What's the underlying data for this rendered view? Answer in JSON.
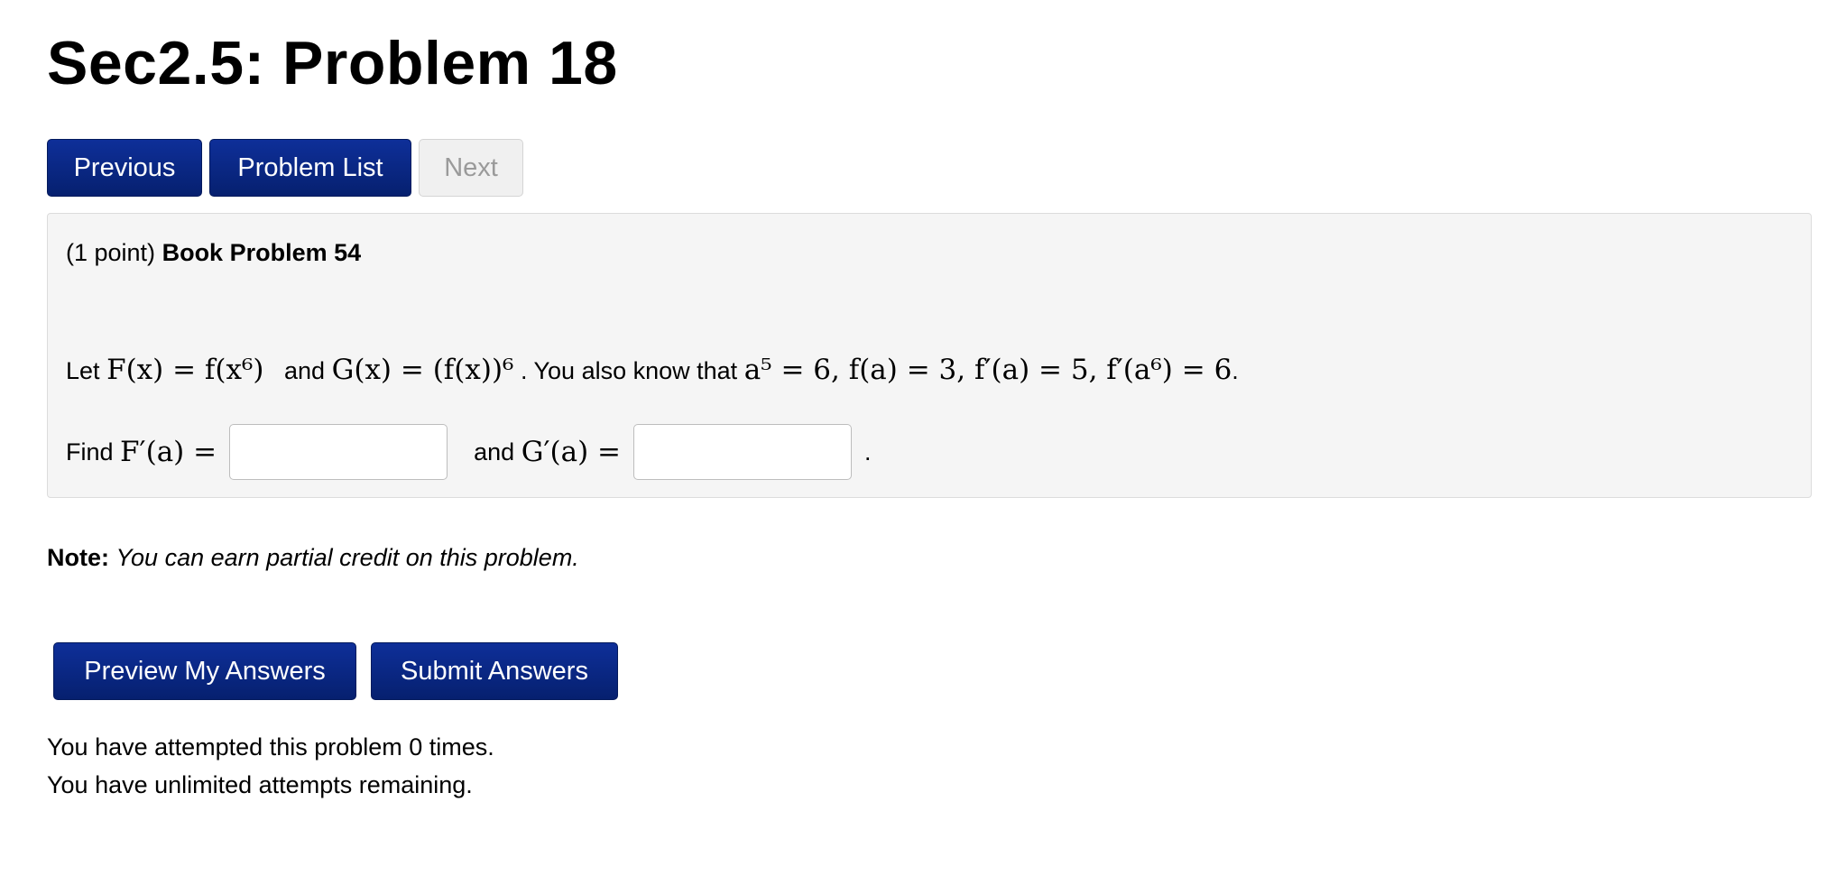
{
  "page": {
    "title": "Sec2.5: Problem 18"
  },
  "nav": {
    "previous_label": "Previous",
    "problem_list_label": "Problem List",
    "next_label": "Next"
  },
  "problem": {
    "points": "(1 point)",
    "name": "Book Problem 54",
    "statement": {
      "let_text": "Let",
      "F_def": "F(x) = f(x⁶)",
      "and_text": "and",
      "G_def": "G(x) = (f(x))⁶",
      "also_text": ". You also know that",
      "given": "a⁵ = 6,  f(a) = 3,  f′(a) = 5,  f′(a⁶) = 6",
      "end": "."
    },
    "find": {
      "find_text": "Find",
      "F_prime": "F′(a) =",
      "and_text": "and",
      "G_prime": "G′(a) =",
      "end": ".",
      "F_answer_value": "",
      "G_answer_value": ""
    }
  },
  "note": {
    "label": "Note:",
    "text": "You can earn partial credit on this problem."
  },
  "actions": {
    "preview_label": "Preview My Answers",
    "submit_label": "Submit Answers"
  },
  "status": {
    "attempted": "You have attempted this problem 0 times.",
    "remaining": "You have unlimited attempts remaining."
  },
  "colors": {
    "primary_button": "#0b2a8c",
    "disabled_button": "#f0f0f0",
    "problem_background": "#f5f5f5"
  }
}
